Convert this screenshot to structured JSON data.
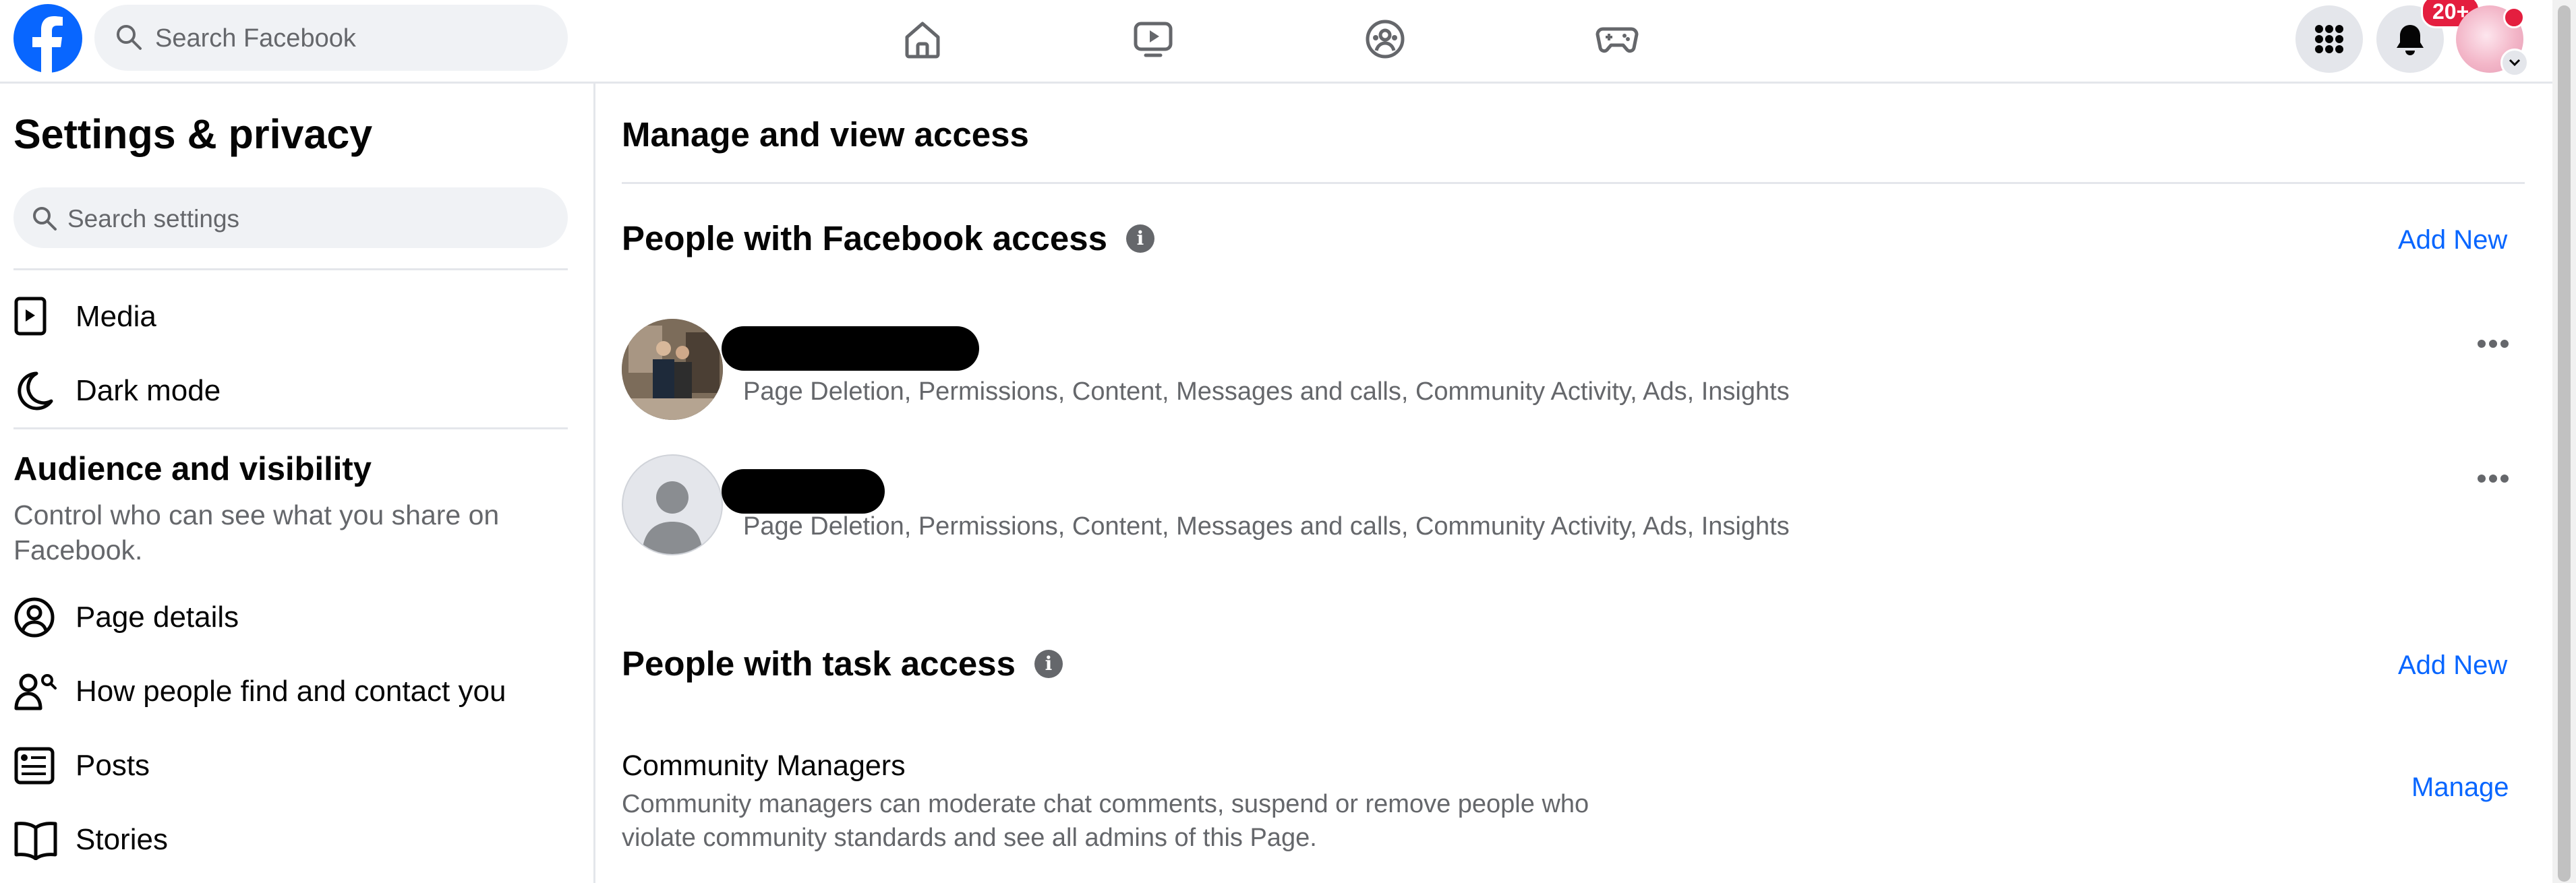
{
  "header": {
    "search_placeholder": "Search Facebook",
    "notification_badge": "20+",
    "nav_icons": [
      "home-icon",
      "watch-icon",
      "groups-icon",
      "gaming-icon"
    ]
  },
  "sidebar": {
    "title": "Settings & privacy",
    "search_placeholder": "Search settings",
    "items_top": [
      {
        "label": "Media",
        "icon": "media-icon"
      },
      {
        "label": "Dark mode",
        "icon": "moon-icon"
      }
    ],
    "section": {
      "title": "Audience and visibility",
      "description": "Control who can see what you share on Facebook."
    },
    "items": [
      {
        "label": "Page details",
        "icon": "user-circle-icon"
      },
      {
        "label": "How people find and contact you",
        "icon": "people-search-icon"
      },
      {
        "label": "Posts",
        "icon": "posts-icon"
      },
      {
        "label": "Stories",
        "icon": "book-icon"
      }
    ]
  },
  "main": {
    "title": "Manage and view access",
    "facebook_access": {
      "title": "People with Facebook access",
      "add_label": "Add New",
      "people": [
        {
          "permissions": "Page Deletion, Permissions, Content, Messages and calls, Community Activity, Ads, Insights"
        },
        {
          "permissions": "Page Deletion, Permissions, Content, Messages and calls, Community Activity, Ads, Insights"
        }
      ]
    },
    "task_access": {
      "title": "People with task access",
      "add_label": "Add New",
      "roles": [
        {
          "title": "Community Managers",
          "description": "Community managers can moderate chat comments, suspend or remove people who violate community standards and see all admins of this Page.",
          "action": "Manage"
        }
      ]
    }
  },
  "colors": {
    "brand": "#0866FF",
    "link": "#0866FF",
    "secondary_text": "#65676B",
    "badge": "#E41E3F"
  }
}
